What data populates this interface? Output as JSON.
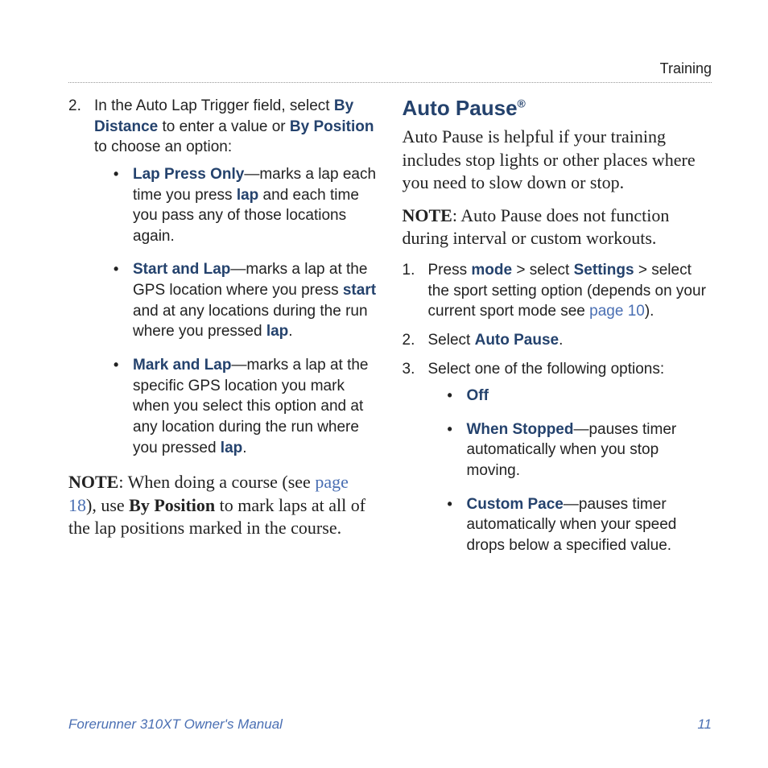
{
  "header": {
    "section": "Training"
  },
  "left": {
    "step2": {
      "num": "2.",
      "text_parts": {
        "p1": "In the Auto Lap Trigger field, select ",
        "b1": "By Distance",
        "p2": " to enter a value or ",
        "b2": "By Position",
        "p3": " to choose an option:"
      }
    },
    "bullets": [
      {
        "title": "Lap Press Only",
        "p1": "—marks a lap each time you press ",
        "b1": "lap",
        "p2": " and each time you pass any of those locations again."
      },
      {
        "title": "Start and Lap",
        "p1": "—marks a lap at the GPS location where you press ",
        "b1": "start",
        "p2": " and at any locations during the run where you pressed ",
        "b2": "lap",
        "p3": "."
      },
      {
        "title": "Mark and Lap",
        "p1": "—marks a lap at the specific GPS location you mark when you select this option and at any location during the run where you pressed ",
        "b1": "lap",
        "p2": "."
      }
    ],
    "note": {
      "label": "NOTE",
      "p1": ": When doing a course (see ",
      "link": "page 18",
      "p2": "), use ",
      "b1": "By Position",
      "p3": " to mark laps at all of the lap positions marked in the course."
    }
  },
  "right": {
    "title": {
      "main": "Auto Pause",
      "sup": "®"
    },
    "intro": "Auto Pause is helpful if your training includes stop lights or other places where you need to slow down or stop.",
    "note": {
      "label": "NOTE",
      "text": ": Auto Pause does not function during interval or custom workouts."
    },
    "step1": {
      "num": "1.",
      "p1": "Press ",
      "b1": "mode",
      "p2": " > select ",
      "b2": "Settings",
      "p3": " > select the sport setting option (depends on your current sport mode see ",
      "link": "page 10",
      "p4": ")."
    },
    "step2": {
      "num": "2.",
      "p1": "Select ",
      "b1": "Auto Pause",
      "p2": "."
    },
    "step3": {
      "num": "3.",
      "p1": "Select one of the following options:"
    },
    "bullets": [
      {
        "title": "Off"
      },
      {
        "title": "When Stopped",
        "p1": "—pauses timer automatically when you stop moving."
      },
      {
        "title": "Custom Pace",
        "p1": "—pauses timer automatically when your speed drops below a specified value."
      }
    ]
  },
  "footer": {
    "left": "Forerunner 310XT Owner's Manual",
    "right": "11"
  }
}
